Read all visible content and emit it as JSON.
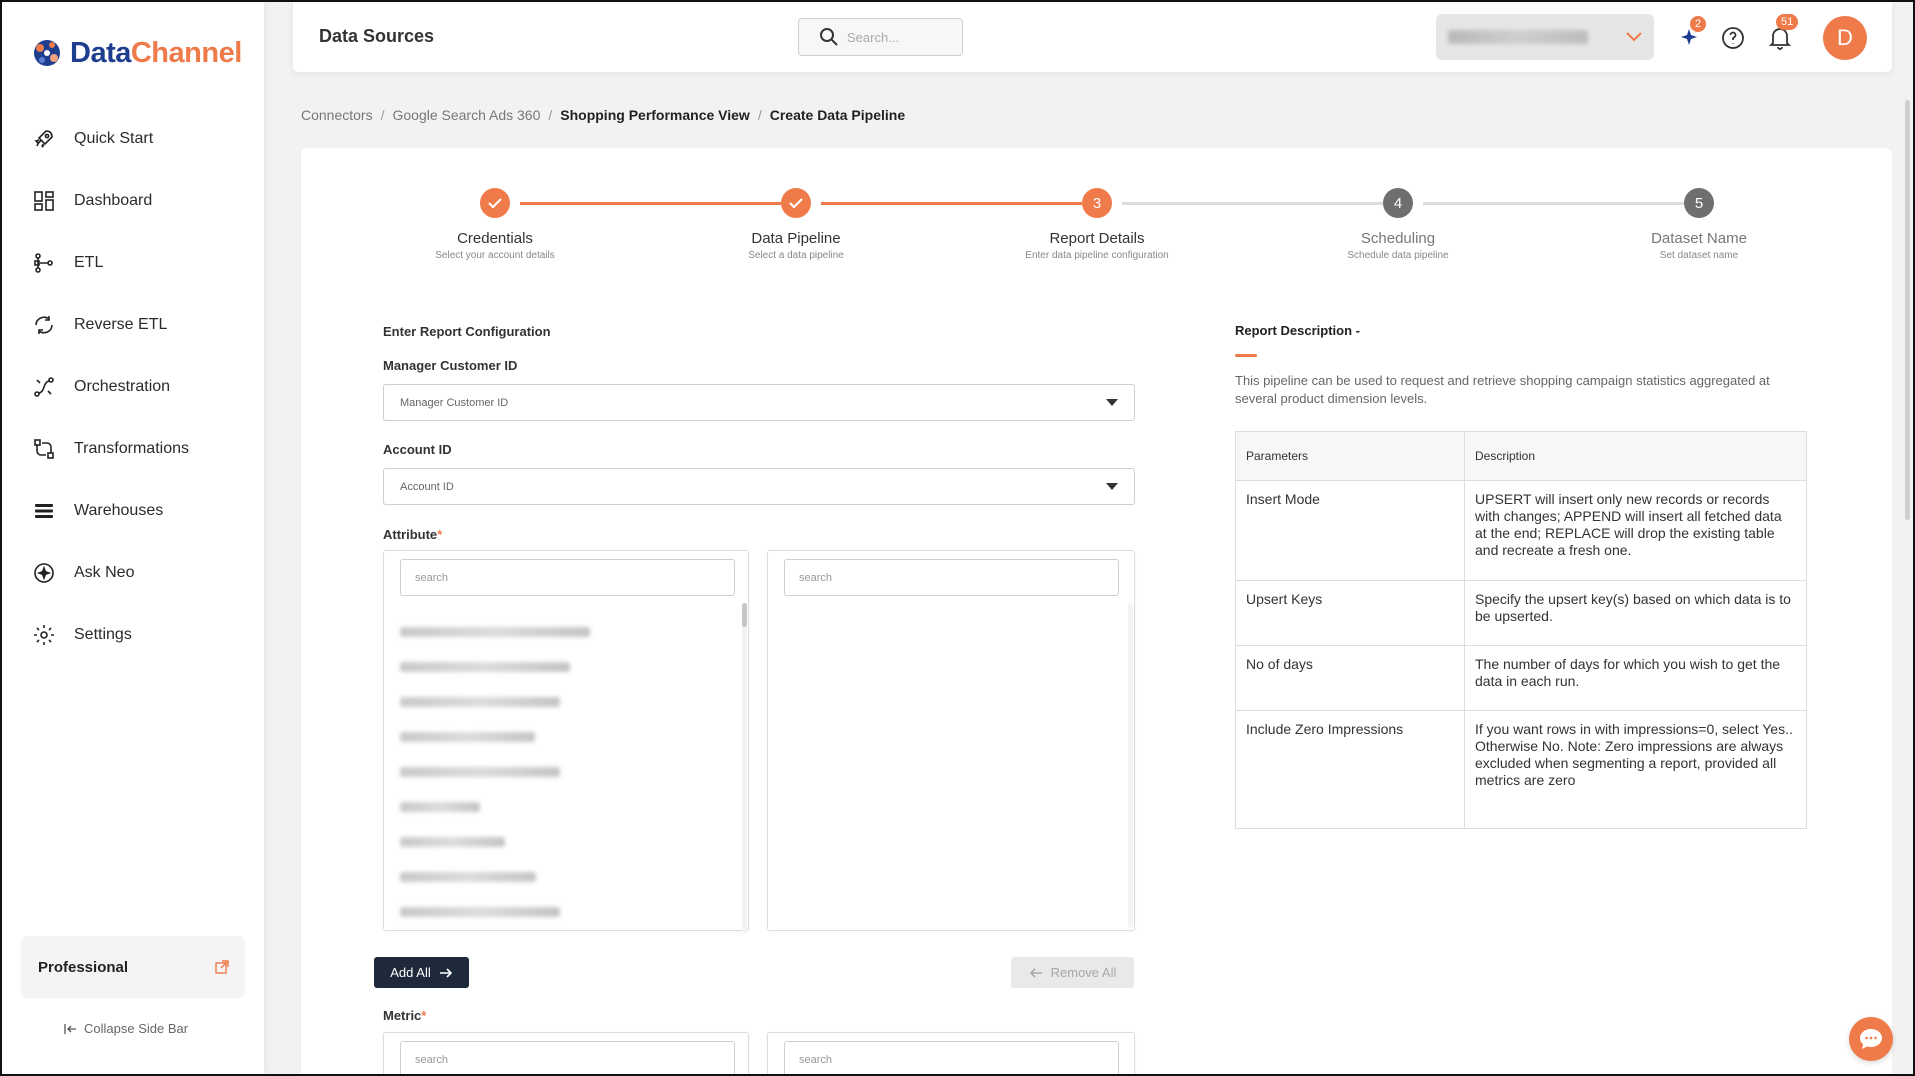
{
  "app": {
    "brand_part1": "Data",
    "brand_part2": "Channel",
    "accent_color": "#ef7a4a",
    "navy_color": "#1e2a3b"
  },
  "sidebar": {
    "items": [
      {
        "label": "Quick Start",
        "icon": "rocket-icon"
      },
      {
        "label": "Dashboard",
        "icon": "dashboard-icon"
      },
      {
        "label": "ETL",
        "icon": "etl-icon"
      },
      {
        "label": "Reverse ETL",
        "icon": "reverse-etl-icon"
      },
      {
        "label": "Orchestration",
        "icon": "orchestration-icon"
      },
      {
        "label": "Transformations",
        "icon": "transformations-icon"
      },
      {
        "label": "Warehouses",
        "icon": "warehouses-icon"
      },
      {
        "label": "Ask Neo",
        "icon": "ask-neo-icon"
      },
      {
        "label": "Settings",
        "icon": "gear-icon"
      }
    ],
    "plan_label": "Professional",
    "collapse_label": "Collapse Side Bar"
  },
  "header": {
    "title": "Data Sources",
    "search_placeholder": "Search...",
    "ai_badge": "2",
    "notifications_badge": "51",
    "avatar_initial": "D"
  },
  "breadcrumb": {
    "items": [
      "Connectors",
      "Google Search Ads 360",
      "Shopping Performance View",
      "Create Data Pipeline"
    ]
  },
  "stepper": {
    "steps": [
      {
        "name": "Credentials",
        "sub": "Select your account details",
        "state": "done",
        "num": "1"
      },
      {
        "name": "Data Pipeline",
        "sub": "Select a data pipeline",
        "state": "done",
        "num": "2"
      },
      {
        "name": "Report Details",
        "sub": "Enter data pipeline configuration",
        "state": "active",
        "num": "3"
      },
      {
        "name": "Scheduling",
        "sub": "Schedule data pipeline",
        "state": "pending",
        "num": "4"
      },
      {
        "name": "Dataset Name",
        "sub": "Set dataset name",
        "state": "pending",
        "num": "5"
      }
    ]
  },
  "form": {
    "section_title": "Enter Report Configuration",
    "manager_label": "Manager Customer ID",
    "manager_placeholder": "Manager Customer ID",
    "account_label": "Account ID",
    "account_placeholder": "Account ID",
    "attribute_label": "Attribute",
    "required_mark": "*",
    "search_placeholder": "search",
    "add_all_label": "Add All",
    "remove_all_label": "Remove All",
    "metric_label": "Metric"
  },
  "report": {
    "title": "Report Description -",
    "description": "This pipeline can be used to request and retrieve shopping campaign statistics aggregated at several product dimension levels.",
    "columns": [
      "Parameters",
      "Description"
    ],
    "rows": [
      {
        "param": "Insert Mode",
        "desc": "UPSERT will insert only new records or records with changes; APPEND will insert all fetched data at the end; REPLACE will drop the existing table and recreate a fresh one."
      },
      {
        "param": "Upsert Keys",
        "desc": "Specify the upsert key(s) based on which data is to be upserted."
      },
      {
        "param": "No of days",
        "desc": "The number of days for which you wish to get the data in each run."
      },
      {
        "param": "Include Zero Impressions",
        "desc": "If you want rows in with impressions=0, select Yes.. Otherwise No. Note: Zero impressions are always excluded when segmenting a report, provided all metrics are zero"
      }
    ]
  }
}
